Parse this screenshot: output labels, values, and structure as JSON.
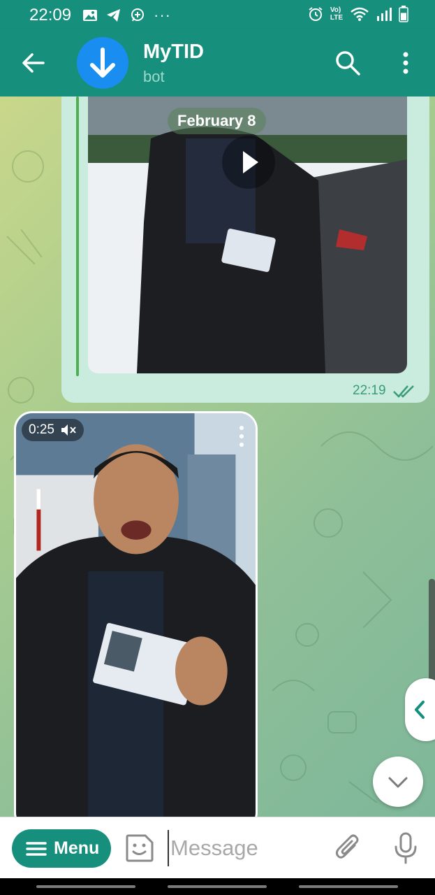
{
  "status_bar": {
    "time": "22:09",
    "left_icons": [
      "image-icon",
      "telegram-icon",
      "whatsapp-icon",
      "more-dots-icon"
    ],
    "right_icons": [
      "alarm-icon",
      "volte-icon",
      "wifi-icon",
      "signal-icon",
      "battery-icon"
    ],
    "volte_line1": "Vo)",
    "volte_line2": "LTE",
    "battery_level": 0.7
  },
  "header": {
    "title": "MyTID",
    "subtitle": "bot",
    "accent_color": "#168f7c",
    "avatar_color": "#1a8ef0",
    "avatar_icon": "download-arrow-icon"
  },
  "chat": {
    "date_chip": "February 8",
    "outgoing_message": {
      "type": "video",
      "time": "22:19",
      "status": "read"
    },
    "video_note": {
      "duration": "0:25",
      "muted": true
    }
  },
  "input_bar": {
    "menu_label": "Menu",
    "placeholder": "Message"
  }
}
